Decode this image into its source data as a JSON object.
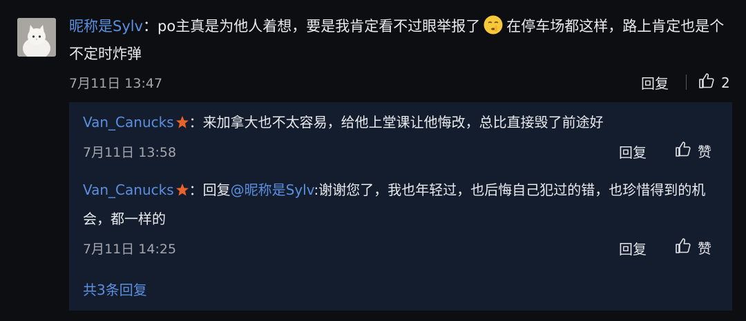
{
  "comment": {
    "username": "昵称是Sylv",
    "separator": "：",
    "text_part1": "po主真是为他人着想，要是我肯定看不过眼举报了",
    "emoji_icon": "shushing-face-emoji-icon",
    "text_part2": "在停车场都这样，路上肯定也是个不定时炸弹",
    "time": "7月11日 13:47",
    "reply_label": "回复",
    "like_count": "2"
  },
  "replies": [
    {
      "username": "Van_Canucks",
      "badge_icon": "star-badge-icon",
      "separator": "：",
      "text": "来加拿大也不太容易，给他上堂课让他悔改，总比直接毁了前途好",
      "time": "7月11日 13:58",
      "reply_label": "回复",
      "like_label": "赞"
    },
    {
      "username": "Van_Canucks",
      "badge_icon": "star-badge-icon",
      "separator": "：",
      "reply_prefix": "回复",
      "mention": "@昵称是Sylv",
      "text": ":谢谢您了，我也年轻过，也后悔自己犯过的错，也珍惜得到的机会，都一样的",
      "time": "7月11日 14:25",
      "reply_label": "回复",
      "like_label": "赞"
    }
  ],
  "total_replies_link": "共3条回复",
  "colors": {
    "background": "#0d0e12",
    "reply_box": "#141d2e",
    "link_blue": "#5b8fe0",
    "badge_orange": "#e8622c"
  }
}
